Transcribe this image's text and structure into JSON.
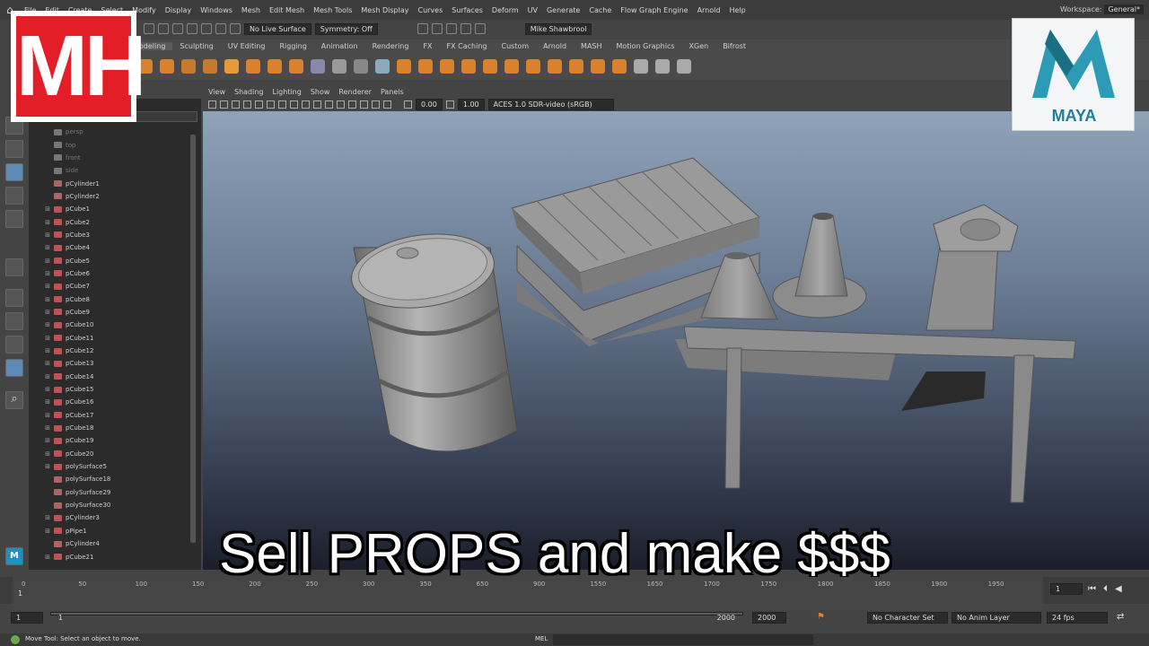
{
  "menu": [
    "File",
    "Edit",
    "Create",
    "Select",
    "Modify",
    "Display",
    "Windows",
    "Mesh",
    "Edit Mesh",
    "Mesh Tools",
    "Mesh Display",
    "Curves",
    "Surfaces",
    "Deform",
    "UV",
    "Generate",
    "Cache",
    "Flow Graph Engine",
    "Arnold",
    "Help"
  ],
  "workspace": {
    "label": "Workspace:",
    "value": "General*"
  },
  "status": {
    "live_surface": "No Live Surface",
    "symmetry": "Symmetry: Off",
    "user": "Mike Shawbrool"
  },
  "shelf_tabs": [
    "Modeling",
    "Sculpting",
    "UV Editing",
    "Rigging",
    "Animation",
    "Rendering",
    "FX",
    "FX Caching",
    "Custom",
    "Arnold",
    "MASH",
    "Motion Graphics",
    "XGen",
    "Bifrost"
  ],
  "shelf_active": "Modeling",
  "viewport": {
    "menu": [
      "View",
      "Shading",
      "Lighting",
      "Show",
      "Renderer",
      "Panels"
    ],
    "exposure": "0.00",
    "gamma": "1.00",
    "color_space": "ACES 1.0 SDR-video (sRGB)"
  },
  "outliner": [
    {
      "name": "persp",
      "type": "cam",
      "expand": false,
      "dim": true
    },
    {
      "name": "top",
      "type": "cam",
      "expand": false,
      "dim": true
    },
    {
      "name": "front",
      "type": "cam",
      "expand": false,
      "dim": true
    },
    {
      "name": "side",
      "type": "cam",
      "expand": false,
      "dim": true
    },
    {
      "name": "pCylinder1",
      "type": "shape",
      "expand": false
    },
    {
      "name": "pCylinder2",
      "type": "shape",
      "expand": false
    },
    {
      "name": "pCube1",
      "type": "mesh",
      "expand": true
    },
    {
      "name": "pCube2",
      "type": "mesh",
      "expand": true
    },
    {
      "name": "pCube3",
      "type": "mesh",
      "expand": true
    },
    {
      "name": "pCube4",
      "type": "mesh",
      "expand": true
    },
    {
      "name": "pCube5",
      "type": "mesh",
      "expand": true
    },
    {
      "name": "pCube6",
      "type": "mesh",
      "expand": true
    },
    {
      "name": "pCube7",
      "type": "mesh",
      "expand": true
    },
    {
      "name": "pCube8",
      "type": "mesh",
      "expand": true
    },
    {
      "name": "pCube9",
      "type": "mesh",
      "expand": true
    },
    {
      "name": "pCube10",
      "type": "mesh",
      "expand": true
    },
    {
      "name": "pCube11",
      "type": "mesh",
      "expand": true
    },
    {
      "name": "pCube12",
      "type": "mesh",
      "expand": true
    },
    {
      "name": "pCube13",
      "type": "mesh",
      "expand": true
    },
    {
      "name": "pCube14",
      "type": "mesh",
      "expand": true
    },
    {
      "name": "pCube15",
      "type": "mesh",
      "expand": true
    },
    {
      "name": "pCube16",
      "type": "mesh",
      "expand": true
    },
    {
      "name": "pCube17",
      "type": "mesh",
      "expand": true
    },
    {
      "name": "pCube18",
      "type": "mesh",
      "expand": true
    },
    {
      "name": "pCube19",
      "type": "mesh",
      "expand": true
    },
    {
      "name": "pCube20",
      "type": "mesh",
      "expand": true
    },
    {
      "name": "polySurface5",
      "type": "mesh",
      "expand": true
    },
    {
      "name": "polySurface18",
      "type": "shape",
      "expand": false
    },
    {
      "name": "polySurface29",
      "type": "shape",
      "expand": false
    },
    {
      "name": "polySurface30",
      "type": "shape",
      "expand": false
    },
    {
      "name": "pCylinder3",
      "type": "mesh",
      "expand": true
    },
    {
      "name": "pPipe1",
      "type": "mesh",
      "expand": true
    },
    {
      "name": "pCylinder4",
      "type": "shape",
      "expand": false
    },
    {
      "name": "pCube21",
      "type": "mesh",
      "expand": true
    }
  ],
  "logos": {
    "left": "MH",
    "right": "MAYA",
    "toolbox_badge": "M"
  },
  "caption": "Sell PROPS and make $$$",
  "timeline": {
    "ticks": [
      "0",
      "50",
      "100",
      "150",
      "200",
      "250",
      "300",
      "350",
      "650",
      "900",
      "1550",
      "1650",
      "1700",
      "1750",
      "1800",
      "1850",
      "1900",
      "1950"
    ],
    "current_frame": "1",
    "current_frame_field": "1"
  },
  "range": {
    "start": "1",
    "inner_start": "1",
    "inner_end": "2000",
    "end": "2000",
    "character_set": "No Character Set",
    "anim_layer": "No Anim Layer",
    "fps": "24 fps"
  },
  "help": {
    "text": "Move Tool: Select an object to move.",
    "mel": "MEL"
  }
}
